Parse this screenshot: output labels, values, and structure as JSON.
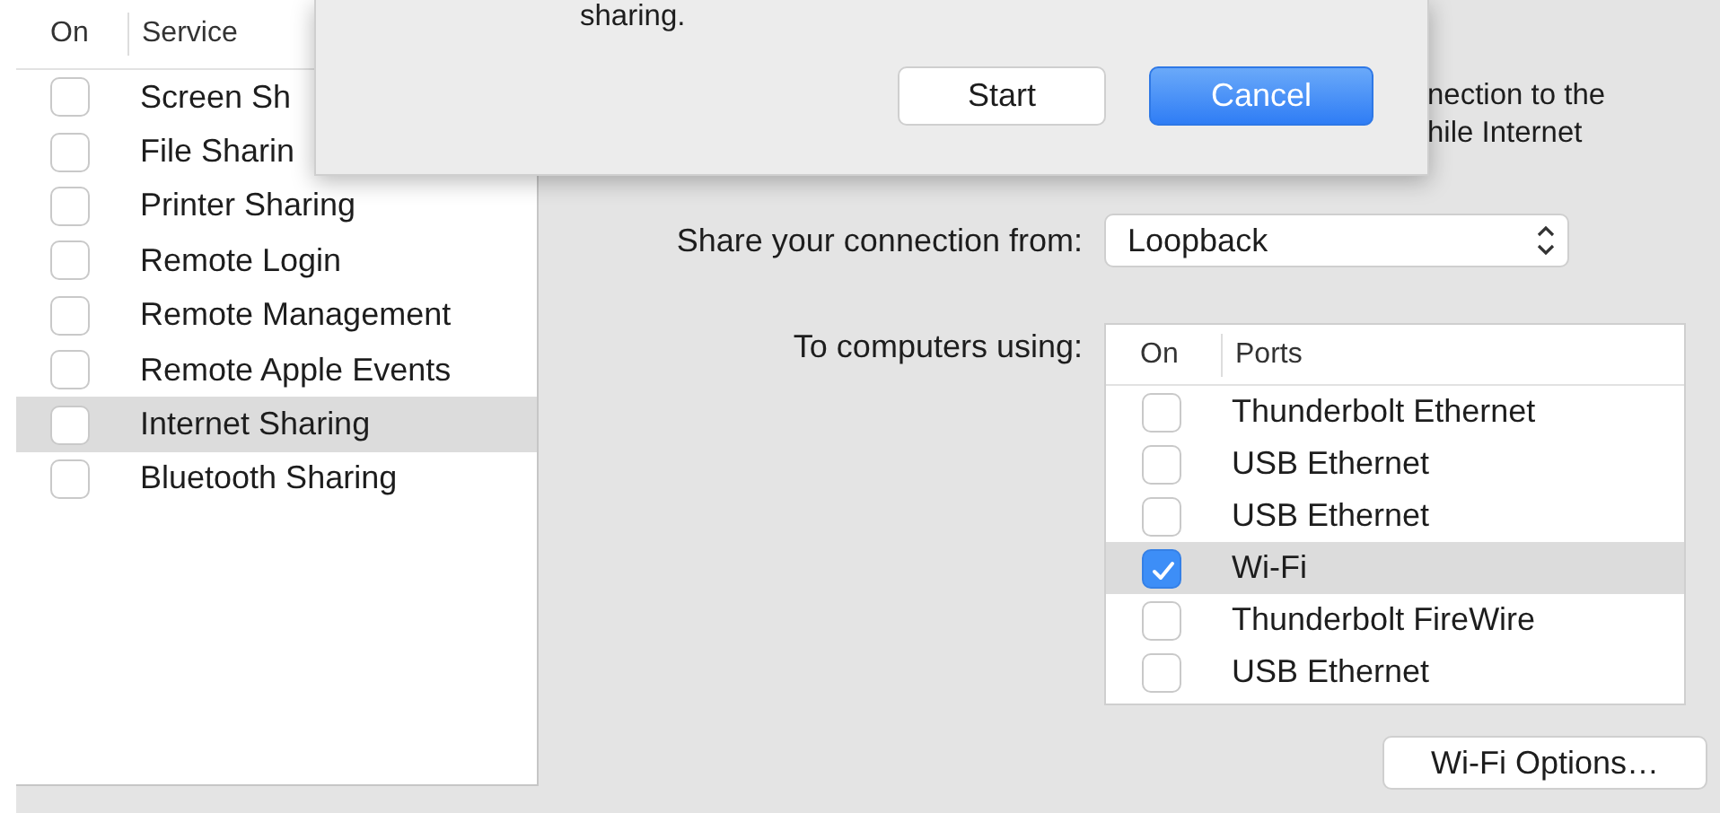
{
  "services": {
    "columns": [
      "On",
      "Service"
    ],
    "items": [
      {
        "name": "Screen Sh",
        "checked": false,
        "selected": false
      },
      {
        "name": "File Sharin",
        "checked": false,
        "selected": false
      },
      {
        "name": "Printer Sharing",
        "checked": false,
        "selected": false
      },
      {
        "name": "Remote Login",
        "checked": false,
        "selected": false
      },
      {
        "name": "Remote Management",
        "checked": false,
        "selected": false
      },
      {
        "name": "Remote Apple Events",
        "checked": false,
        "selected": false
      },
      {
        "name": "Internet Sharing",
        "checked": false,
        "selected": true
      },
      {
        "name": "Bluetooth Sharing",
        "checked": false,
        "selected": false
      }
    ]
  },
  "sheet": {
    "message": "sharing.",
    "buttons": [
      {
        "label": "Start",
        "default": false
      },
      {
        "label": "Cancel",
        "default": true
      }
    ]
  },
  "description": {
    "lines": [
      "nection to the",
      "hile Internet"
    ]
  },
  "share_from": {
    "label": "Share your connection from:",
    "value": "Loopback"
  },
  "to_computers": {
    "label": "To computers using:",
    "columns": [
      "On",
      "Ports"
    ],
    "ports": [
      {
        "name": "Thunderbolt Ethernet",
        "checked": false,
        "selected": false
      },
      {
        "name": "USB Ethernet",
        "checked": false,
        "selected": false
      },
      {
        "name": "USB Ethernet",
        "checked": false,
        "selected": false
      },
      {
        "name": "Wi-Fi",
        "checked": true,
        "selected": true
      },
      {
        "name": "Thunderbolt FireWire",
        "checked": false,
        "selected": false
      },
      {
        "name": "USB Ethernet",
        "checked": false,
        "selected": false
      }
    ]
  },
  "options_button": "Wi-Fi Options…"
}
